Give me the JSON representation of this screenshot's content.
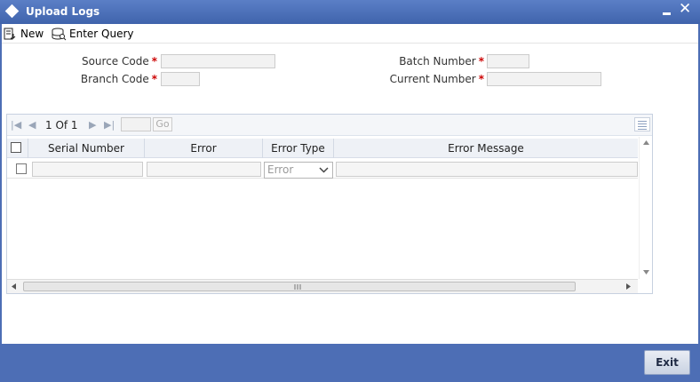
{
  "window": {
    "title": "Upload Logs"
  },
  "toolbar": {
    "new_label": "New",
    "enter_query_label": "Enter Query"
  },
  "form": {
    "source_code_label": "Source Code",
    "branch_code_label": "Branch Code",
    "batch_number_label": "Batch Number",
    "current_number_label": "Current Number",
    "required_marker": "*"
  },
  "pager": {
    "page_text": "1 Of 1",
    "go_label": "Go"
  },
  "grid": {
    "columns": [
      "Serial Number",
      "Error",
      "Error Type",
      "Error Message"
    ],
    "rows": [
      {
        "serial_number": "",
        "error": "",
        "error_type": "Error",
        "error_message": ""
      }
    ]
  },
  "footer": {
    "exit_label": "Exit"
  },
  "colors": {
    "frame": "#4d6eb5",
    "required": "#cc0000"
  }
}
